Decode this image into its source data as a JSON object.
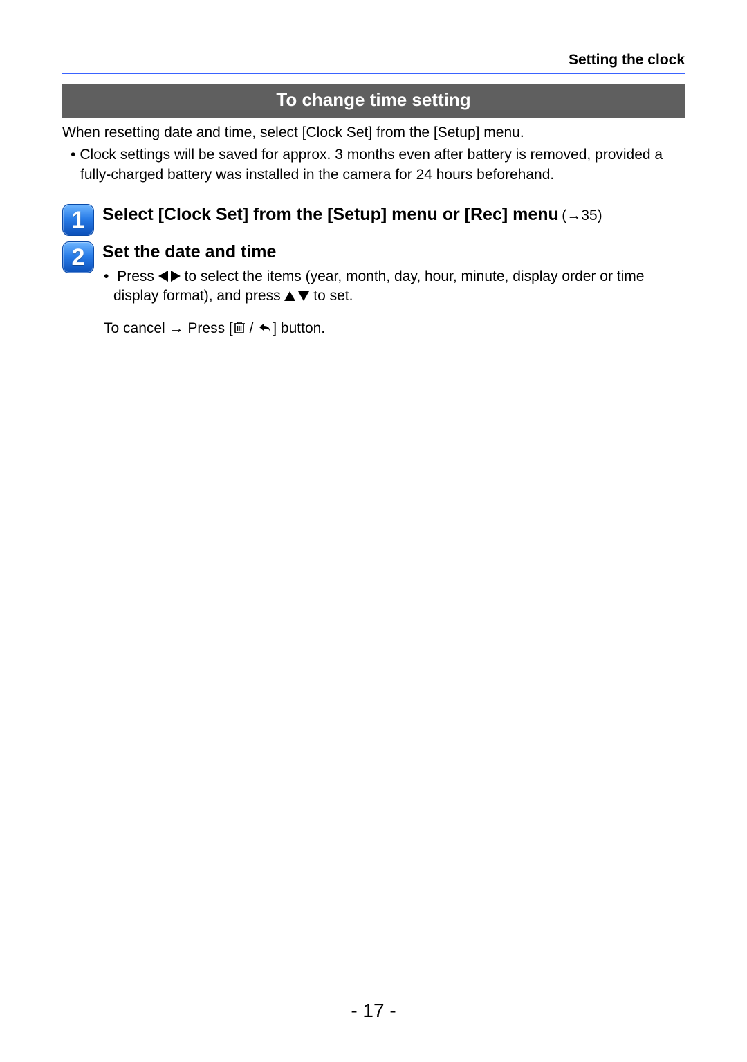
{
  "header": {
    "chapter_title": "Setting the clock"
  },
  "section": {
    "title": "To change time setting",
    "intro": "When resetting date and time, select [Clock Set] from the [Setup] menu.",
    "notes": [
      "Clock settings will be saved for approx. 3 months even after battery is removed, provided a fully-charged battery was installed in the camera for 24 hours beforehand."
    ]
  },
  "steps": [
    {
      "number": "1",
      "title": "Select [Clock Set] from the [Setup] menu or [Rec] menu",
      "ref": "(→35)"
    },
    {
      "number": "2",
      "title": "Set the date and time",
      "details": {
        "press_prefix": "Press ",
        "press_mid": " to select the items (year, month, day, hour, minute, display order or time display format), and press ",
        "press_suffix": " to set."
      },
      "cancel": {
        "prefix": "To cancel → Press [",
        "sep": " / ",
        "suffix": "] button."
      }
    }
  ],
  "icons": {
    "left_right": "left-right-triangles",
    "up_down": "up-down-triangles",
    "trash": "trash-icon",
    "return": "return-icon"
  },
  "page_number": "- 17 -"
}
